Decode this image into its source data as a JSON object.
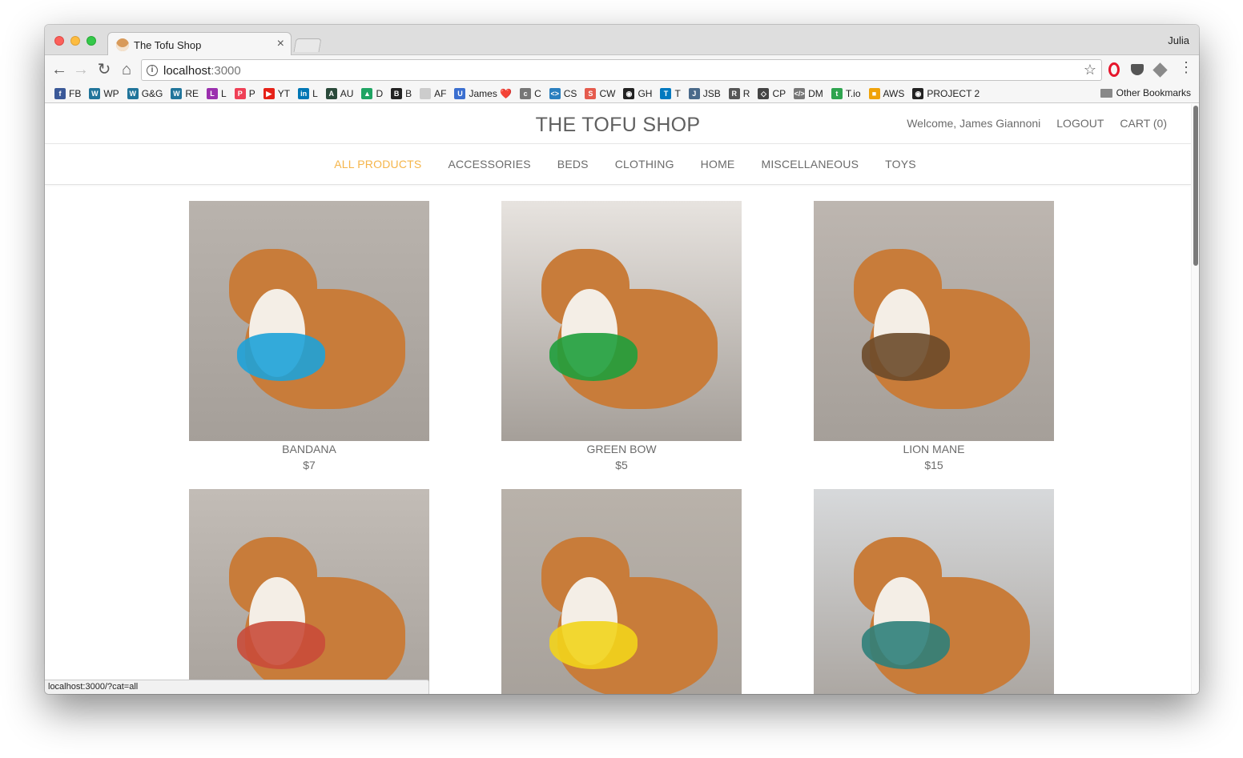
{
  "browser": {
    "tab_title": "The Tofu Shop",
    "tab_close": "×",
    "profile_name": "Julia",
    "back_icon": "←",
    "forward_icon": "→",
    "reload_icon": "↻",
    "home_icon": "⌂",
    "info_icon": "i",
    "url_host": "localhost",
    "url_port": ":3000",
    "star_icon": "☆",
    "menu_icon": "⋮",
    "status_url": "localhost:3000/?cat=all"
  },
  "bookmarks": [
    {
      "label": "FB",
      "icon": "f",
      "color": "#3b5998"
    },
    {
      "label": "WP",
      "icon": "W",
      "color": "#21759b"
    },
    {
      "label": "G&G",
      "icon": "W",
      "color": "#21759b"
    },
    {
      "label": "RE",
      "icon": "W",
      "color": "#21759b"
    },
    {
      "label": "L",
      "icon": "L",
      "color": "#9b2fae"
    },
    {
      "label": "P",
      "icon": "P",
      "color": "#ef4056"
    },
    {
      "label": "YT",
      "icon": "▶",
      "color": "#e62117"
    },
    {
      "label": "L",
      "icon": "in",
      "color": "#0077b5"
    },
    {
      "label": "AU",
      "icon": "A",
      "color": "#2a4a3a"
    },
    {
      "label": "D",
      "icon": "▲",
      "color": "#1fa463"
    },
    {
      "label": "B",
      "icon": "B",
      "color": "#222222"
    },
    {
      "label": "AF",
      "icon": "",
      "color": "#cccccc"
    },
    {
      "label": "James ❤️",
      "icon": "U",
      "color": "#3b6fd0"
    },
    {
      "label": "C",
      "icon": "c",
      "color": "#777777"
    },
    {
      "label": "CS",
      "icon": "<>",
      "color": "#2a7fbf"
    },
    {
      "label": "CW",
      "icon": "S",
      "color": "#e55b4d"
    },
    {
      "label": "GH",
      "icon": "◉",
      "color": "#222222"
    },
    {
      "label": "T",
      "icon": "T",
      "color": "#0079bf"
    },
    {
      "label": "JSB",
      "icon": "J",
      "color": "#4a6a8a"
    },
    {
      "label": "R",
      "icon": "R",
      "color": "#555555"
    },
    {
      "label": "CP",
      "icon": "◇",
      "color": "#444444"
    },
    {
      "label": "DM",
      "icon": "</>",
      "color": "#777777"
    },
    {
      "label": "T.io",
      "icon": "t",
      "color": "#2ea44f"
    },
    {
      "label": "AWS",
      "icon": "■",
      "color": "#f0a30a"
    },
    {
      "label": "PROJECT 2",
      "icon": "◉",
      "color": "#222222"
    }
  ],
  "other_bookmarks": "Other Bookmarks",
  "site": {
    "title": "THE TOFU SHOP",
    "welcome": "Welcome, James Giannoni",
    "logout": "LOGOUT",
    "cart": "CART (0)"
  },
  "categories": [
    {
      "label": "ALL PRODUCTS",
      "active": true
    },
    {
      "label": "ACCESSORIES",
      "active": false
    },
    {
      "label": "BEDS",
      "active": false
    },
    {
      "label": "CLOTHING",
      "active": false
    },
    {
      "label": "HOME",
      "active": false
    },
    {
      "label": "MISCELLANEOUS",
      "active": false
    },
    {
      "label": "TOYS",
      "active": false
    }
  ],
  "products": [
    {
      "name": "BANDANA",
      "price": "$7",
      "bg": "#b9b3ad",
      "accent": "#1ea2d8"
    },
    {
      "name": "GREEN BOW",
      "price": "$5",
      "bg": "#e7e3df",
      "accent": "#1f9e3c"
    },
    {
      "name": "LION MANE",
      "price": "$15",
      "bg": "#bdb6b0",
      "accent": "#6b4a2a"
    },
    {
      "name": "",
      "price": "",
      "bg": "#c2bcb6",
      "accent": "#c94b3a"
    },
    {
      "name": "",
      "price": "",
      "bg": "#b9b2aa",
      "accent": "#f2d41c"
    },
    {
      "name": "",
      "price": "",
      "bg": "#d7d9db",
      "accent": "#2f7f7a"
    }
  ]
}
